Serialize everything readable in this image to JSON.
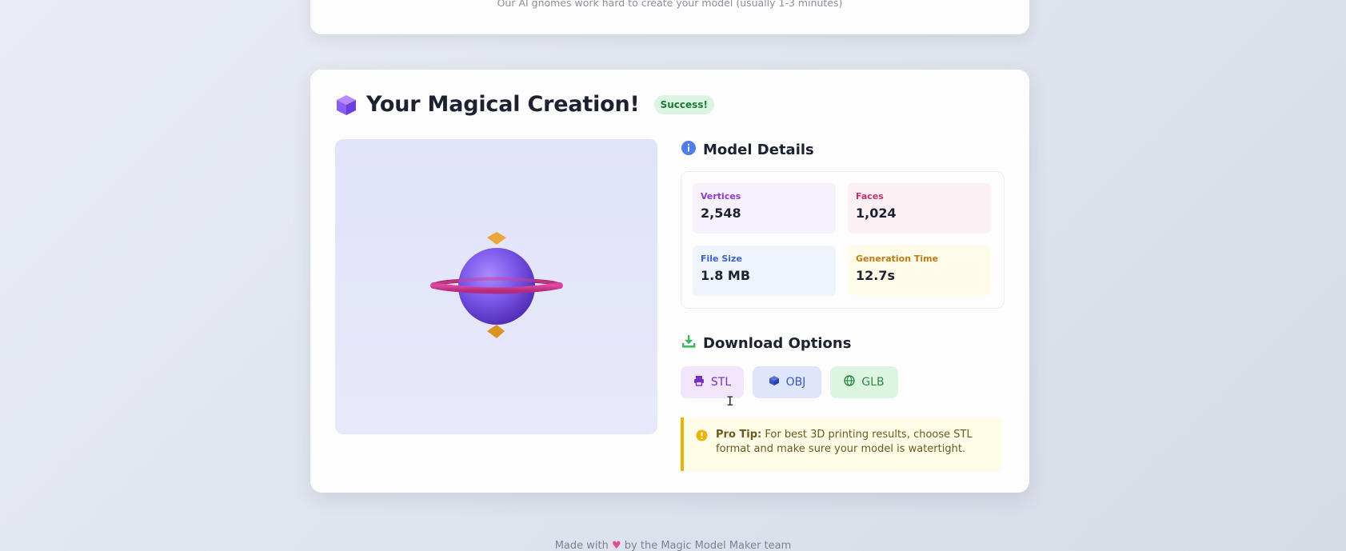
{
  "top_card": {
    "subtitle": "Our AI gnomes work hard to create your model (usually 1-3 minutes)"
  },
  "result": {
    "title": "Your Magical Creation!",
    "status_badge": "Success!",
    "icon": "cube-icon"
  },
  "details": {
    "heading": "Model Details",
    "icon": "info-icon",
    "stats": [
      {
        "label": "Vertices",
        "value": "2,548"
      },
      {
        "label": "Faces",
        "value": "1,024"
      },
      {
        "label": "File Size",
        "value": "1.8 MB"
      },
      {
        "label": "Generation Time",
        "value": "12.7s"
      }
    ]
  },
  "downloads": {
    "heading": "Download Options",
    "icon": "download-icon",
    "buttons": [
      {
        "label": "STL",
        "icon": "printer-icon"
      },
      {
        "label": "OBJ",
        "icon": "cube-icon"
      },
      {
        "label": "GLB",
        "icon": "globe-icon"
      }
    ]
  },
  "tip": {
    "label": "Pro Tip:",
    "text": "For best 3D printing results, choose STL format and make sure your model is watertight.",
    "icon": "warning-icon"
  },
  "footer": {
    "text_before": "Made with",
    "heart": "♥",
    "text_after": "by the Magic Model Maker team"
  },
  "colors": {
    "accent_purple": "#8b5cf6",
    "success": "#1f7a3a",
    "tip_border": "#eab308"
  }
}
